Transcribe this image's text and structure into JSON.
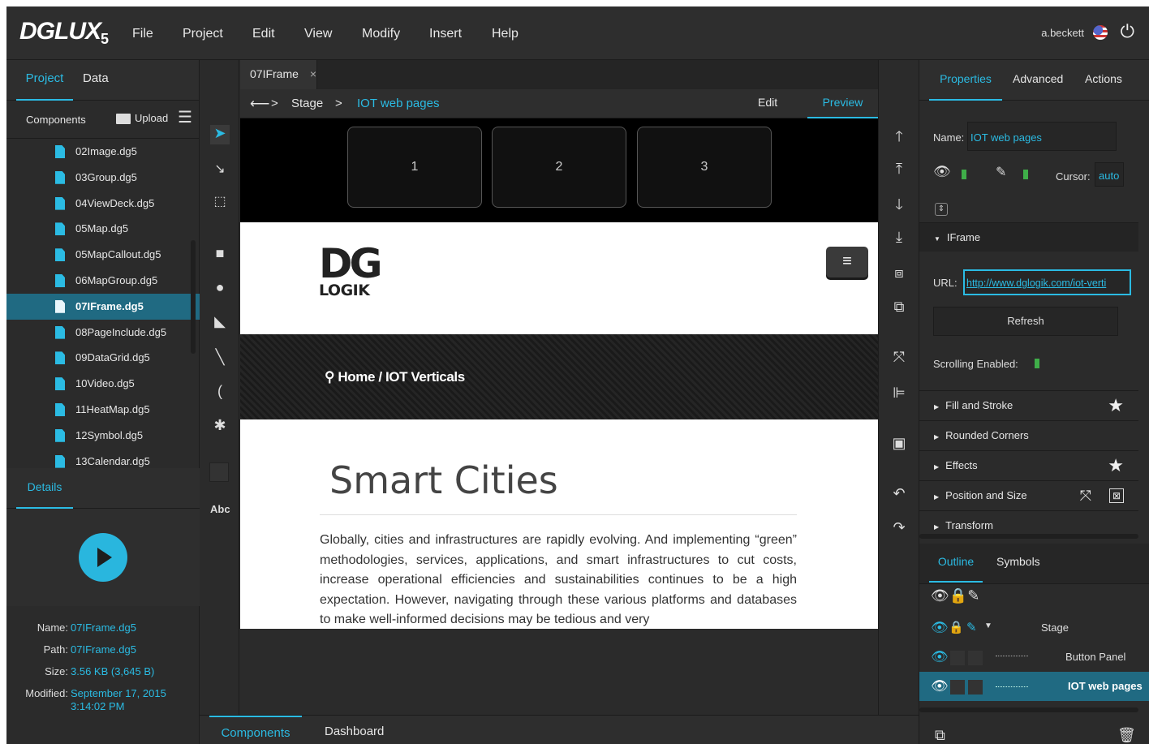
{
  "app": {
    "logo": "DGLUX",
    "logo_version": "5",
    "user": "a.beckett"
  },
  "menu": [
    "File",
    "Project",
    "Edit",
    "View",
    "Modify",
    "Insert",
    "Help"
  ],
  "left": {
    "tabs": [
      "Project",
      "Data"
    ],
    "components_label": "Components",
    "upload_label": "Upload",
    "files": [
      "02Image.dg5",
      "03Group.dg5",
      "04ViewDeck.dg5",
      "05Map.dg5",
      "05MapCallout.dg5",
      "06MapGroup.dg5",
      "07IFrame.dg5",
      "08PageInclude.dg5",
      "09DataGrid.dg5",
      "10Video.dg5",
      "11HeatMap.dg5",
      "12Symbol.dg5",
      "13Calendar.dg5"
    ],
    "selected_file": "07IFrame.dg5",
    "details_tab": "Details",
    "details": {
      "name_label": "Name:",
      "name": "07IFrame.dg5",
      "path_label": "Path:",
      "path": "07IFrame.dg5",
      "size_label": "Size:",
      "size": "3.56 KB (3,645 B)",
      "modified_label": "Modified:",
      "modified_date": "September 17, 2015",
      "modified_time": "3:14:02 PM"
    }
  },
  "tools": {
    "text_tool": "Abc"
  },
  "center": {
    "doc_tab": "07IFrame",
    "close": "×",
    "breadcrumb": {
      "root": "Stage",
      "sep": ">",
      "current": "IOT web pages"
    },
    "modes": {
      "edit": "Edit",
      "preview": "Preview"
    },
    "panel_buttons": [
      "1",
      "2",
      "3"
    ],
    "iframe": {
      "logo_top": "DG",
      "logo_bottom": "LOGIK",
      "menu_icon": "≡",
      "crumb": "Home / IOT Verticals",
      "heading": "Smart Cities",
      "paragraph": "Globally, cities and infrastructures are rapidly evolving. And implementing “green” methodologies, services, applications, and smart infrastructures to cut costs, increase operational efficiencies and sustainabilities continues to be a high expectation. However, navigating through these various platforms and databases to make well-informed decisions may be tedious and very"
    }
  },
  "bottom_tabs": [
    "Components",
    "Dashboard"
  ],
  "props": {
    "tabs": [
      "Properties",
      "Advanced",
      "Actions"
    ],
    "name_label": "Name:",
    "name_value": "IOT web pages",
    "cursor_label": "Cursor:",
    "cursor_value": "auto",
    "iframe_section": "IFrame",
    "url_label": "URL:",
    "url_value": "http://www.dglogik.com/iot-verti",
    "refresh": "Refresh",
    "scrolling_label": "Scrolling Enabled:",
    "sections": [
      "Fill and Stroke",
      "Rounded Corners",
      "Effects",
      "Position and Size",
      "Transform"
    ],
    "outline_tabs": [
      "Outline",
      "Symbols"
    ],
    "outline": [
      {
        "label": "Stage"
      },
      {
        "label": "Button Panel"
      },
      {
        "label": "IOT web pages"
      }
    ]
  },
  "colors": {
    "accent": "#2bbbe3",
    "selected_row": "#206a82",
    "background": "#2b2b2b"
  }
}
